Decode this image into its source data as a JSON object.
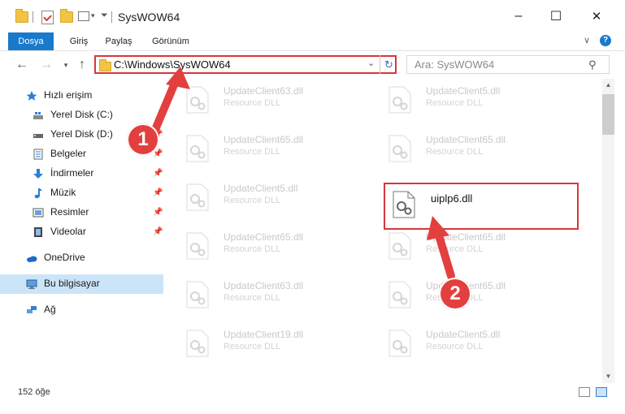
{
  "window": {
    "title": "SysWOW64",
    "minimize": "–",
    "maximize": "☐",
    "close": "✕",
    "help": "?",
    "collapse": "∨"
  },
  "ribbon": {
    "tabs": [
      {
        "label": "Dosya"
      },
      {
        "label": "Giriş"
      },
      {
        "label": "Paylaş"
      },
      {
        "label": "Görünüm"
      }
    ]
  },
  "address": {
    "path": "C:\\Windows\\SysWOW64",
    "search_placeholder": "Ara: SysWOW64"
  },
  "nav": {
    "items": [
      {
        "label": "Hızlı erişim",
        "icon": "star-icon"
      },
      {
        "label": "Yerel Disk (C:)",
        "icon": "drive-icon"
      },
      {
        "label": "Yerel Disk (D:)",
        "icon": "drive-icon"
      },
      {
        "label": "Belgeler",
        "icon": "documents-icon"
      },
      {
        "label": "İndirmeler",
        "icon": "download-icon"
      },
      {
        "label": "Müzik",
        "icon": "music-icon"
      },
      {
        "label": "Resimler",
        "icon": "pictures-icon"
      },
      {
        "label": "Videolar",
        "icon": "videos-icon"
      },
      {
        "label": "OneDrive",
        "icon": "cloud-icon"
      },
      {
        "label": "Bu bilgisayar",
        "icon": "computer-icon"
      },
      {
        "label": "Ağ",
        "icon": "network-icon"
      }
    ]
  },
  "files": [
    {
      "name": "UpdateClient63.dll",
      "type": "Resource DLL"
    },
    {
      "name": "UpdateClient5.dll",
      "type": "Resource DLL"
    },
    {
      "name": "UpdateClient65.dll",
      "type": "Resource DLL"
    },
    {
      "name": "UpdateClient65.dll",
      "type": "Resource DLL"
    },
    {
      "name": "UpdateClient5.dll",
      "type": "Resource DLL"
    },
    {
      "name": "uiplp6.dll",
      "type": ""
    },
    {
      "name": "UpdateClient65.dll",
      "type": "Resource DLL"
    },
    {
      "name": "UpdateClient65.dll",
      "type": "Resource DLL"
    },
    {
      "name": "UpdateClient63.dll",
      "type": "Resource DLL"
    },
    {
      "name": "UpdateClient65.dll",
      "type": "Resource DLL"
    },
    {
      "name": "UpdateClient19.dll",
      "type": "Resource DLL"
    },
    {
      "name": "UpdateClient5.dll",
      "type": "Resource DLL"
    }
  ],
  "status": {
    "count": "152 öğe"
  },
  "callouts": {
    "one": "1",
    "two": "2"
  },
  "colors": {
    "accent": "#1979ca",
    "highlight": "#d9373a",
    "callout": "#e2403e"
  }
}
